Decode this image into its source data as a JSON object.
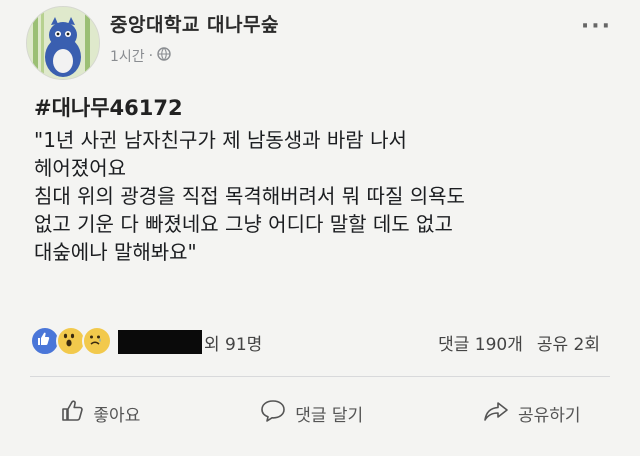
{
  "post": {
    "page_name": "중앙대학교 대나무숲",
    "time": "1시간",
    "separator": "·",
    "privacy_icon": "globe-icon",
    "hashtag": "#대나무46172",
    "lines": [
      "\"1년 사귄 남자친구가 제 남동생과 바람 나서",
      "헤어졌어요",
      "침대 위의 광경을 직접 목격해버려서 뭐 따질 의욕도",
      "없고 기운 다 빠졌네요 그냥 어디다 말할 데도 없고",
      "대숲에나 말해봐요\""
    ]
  },
  "reactions": {
    "icons": [
      "like-icon",
      "wow-icon",
      "sad-icon"
    ],
    "count_text": "외 91명",
    "comments": "댓글 190개",
    "shares": "공유 2회"
  },
  "actions": {
    "like": "좋아요",
    "comment": "댓글 달기",
    "share": "공유하기"
  },
  "colors": {
    "like": "#4a76d8",
    "reaction_yellow": "#f2c94c",
    "redaction": "#0a0a0a"
  }
}
